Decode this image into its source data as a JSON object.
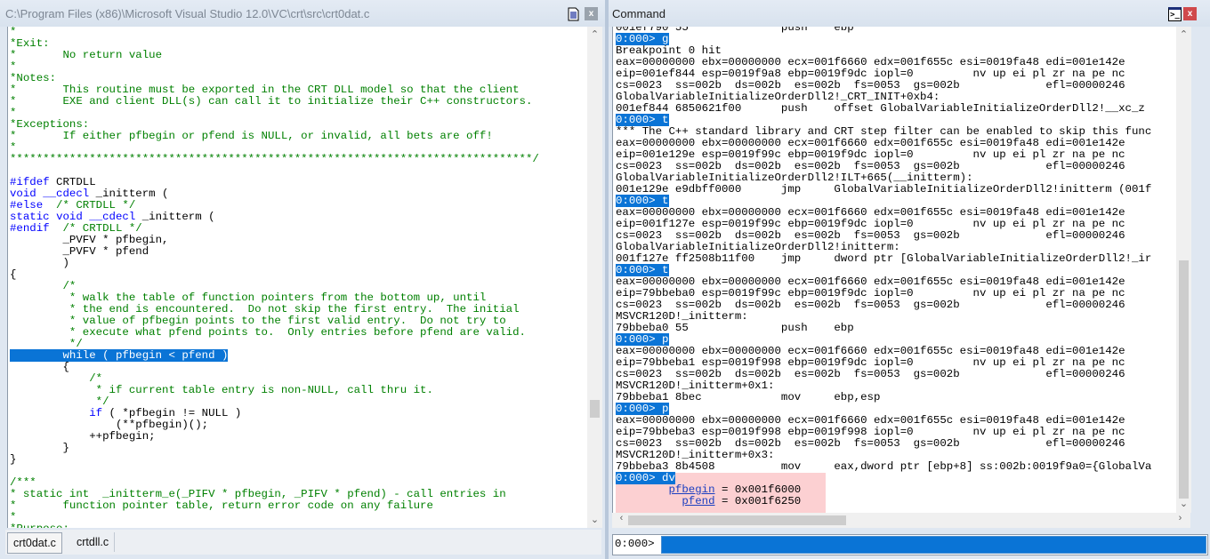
{
  "source_window": {
    "title": "C:\\Program Files (x86)\\Microsoft Visual Studio 12.0\\VC\\crt\\src\\crt0dat.c",
    "close_label": "x",
    "lines": [
      [
        {
          "t": "*",
          "s": "c"
        }
      ],
      [
        {
          "t": "*Exit:",
          "s": "c"
        }
      ],
      [
        {
          "t": "*       No return value",
          "s": "c"
        }
      ],
      [
        {
          "t": "*",
          "s": "c"
        }
      ],
      [
        {
          "t": "*Notes:",
          "s": "c"
        }
      ],
      [
        {
          "t": "*       This routine must be exported in the CRT DLL model so that the client",
          "s": "c"
        }
      ],
      [
        {
          "t": "*       EXE and client DLL(s) can call it to initialize their C++ constructors.",
          "s": "c"
        }
      ],
      [
        {
          "t": "*",
          "s": "c"
        }
      ],
      [
        {
          "t": "*Exceptions:",
          "s": "c"
        }
      ],
      [
        {
          "t": "*       If either pfbegin or pfend is NULL, or invalid, all bets are off!",
          "s": "c"
        }
      ],
      [
        {
          "t": "*",
          "s": "c"
        }
      ],
      [
        {
          "t": "*******************************************************************************/",
          "s": "c"
        }
      ],
      [
        {
          "t": "",
          "s": "p"
        }
      ],
      [
        {
          "t": "#ifdef",
          "s": "k"
        },
        {
          "t": " CRTDLL",
          "s": "p"
        }
      ],
      [
        {
          "t": "void",
          "s": "k"
        },
        {
          "t": " ",
          "s": "p"
        },
        {
          "t": "__cdecl",
          "s": "k"
        },
        {
          "t": " _initterm (",
          "s": "p"
        }
      ],
      [
        {
          "t": "#else",
          "s": "k"
        },
        {
          "t": "  /* CRTDLL */",
          "s": "c"
        }
      ],
      [
        {
          "t": "static",
          "s": "k"
        },
        {
          "t": " ",
          "s": "p"
        },
        {
          "t": "void",
          "s": "k"
        },
        {
          "t": " ",
          "s": "p"
        },
        {
          "t": "__cdecl",
          "s": "k"
        },
        {
          "t": " _initterm (",
          "s": "p"
        }
      ],
      [
        {
          "t": "#endif",
          "s": "k"
        },
        {
          "t": "  /* CRTDLL */",
          "s": "c"
        }
      ],
      [
        {
          "t": "        _PVFV * pfbegin,",
          "s": "p"
        }
      ],
      [
        {
          "t": "        _PVFV * pfend",
          "s": "p"
        }
      ],
      [
        {
          "t": "        )",
          "s": "p"
        }
      ],
      [
        {
          "t": "{",
          "s": "p"
        }
      ],
      [
        {
          "t": "        /*",
          "s": "c"
        }
      ],
      [
        {
          "t": "         * walk the table of function pointers from the bottom up, until",
          "s": "c"
        }
      ],
      [
        {
          "t": "         * the end is encountered.  Do not skip the first entry.  The initial",
          "s": "c"
        }
      ],
      [
        {
          "t": "         * value of pfbegin points to the first valid entry.  Do not try to",
          "s": "c"
        }
      ],
      [
        {
          "t": "         * execute what pfend points to.  Only entries before pfend are valid.",
          "s": "c"
        }
      ],
      [
        {
          "t": "         */",
          "s": "c"
        }
      ],
      [
        {
          "t": "        while ( pfbegin < pfend )",
          "s": "sel"
        }
      ],
      [
        {
          "t": "        {",
          "s": "p"
        }
      ],
      [
        {
          "t": "            /*",
          "s": "c"
        }
      ],
      [
        {
          "t": "             * if current table entry is non-NULL, call thru it.",
          "s": "c"
        }
      ],
      [
        {
          "t": "             */",
          "s": "c"
        }
      ],
      [
        {
          "t": "            ",
          "s": "p"
        },
        {
          "t": "if",
          "s": "k"
        },
        {
          "t": " ( *pfbegin != NULL )",
          "s": "p"
        }
      ],
      [
        {
          "t": "                (**pfbegin)();",
          "s": "p"
        }
      ],
      [
        {
          "t": "            ++pfbegin;",
          "s": "p"
        }
      ],
      [
        {
          "t": "        }",
          "s": "p"
        }
      ],
      [
        {
          "t": "}",
          "s": "p"
        }
      ],
      [
        {
          "t": "",
          "s": "p"
        }
      ],
      [
        {
          "t": "/***",
          "s": "c"
        }
      ],
      [
        {
          "t": "* static int  _initterm_e(_PIFV * pfbegin, _PIFV * pfend) - call entries in",
          "s": "c"
        }
      ],
      [
        {
          "t": "*       function pointer table, return error code on any failure",
          "s": "c"
        }
      ],
      [
        {
          "t": "*",
          "s": "c"
        }
      ],
      [
        {
          "t": "*Purpose:",
          "s": "c"
        }
      ]
    ],
    "tabs": [
      {
        "label": "crt0dat.c",
        "active": true
      },
      {
        "label": "crtdll.c",
        "active": false
      }
    ]
  },
  "command_window": {
    "title": "Command",
    "close_label": "x",
    "output": [
      [
        {
          "t": "001ef790 55              push    ebp",
          "s": "p"
        }
      ],
      [
        {
          "t": "0:000> g",
          "s": "prompt"
        }
      ],
      [
        {
          "t": "Breakpoint 0 hit",
          "s": "p"
        }
      ],
      [
        {
          "t": "eax=00000000 ebx=00000000 ecx=001f6660 edx=001f655c esi=0019fa48 edi=001e142e",
          "s": "p"
        }
      ],
      [
        {
          "t": "eip=001ef844 esp=0019f9a8 ebp=0019f9dc iopl=0         nv up ei pl zr na pe nc",
          "s": "p"
        }
      ],
      [
        {
          "t": "cs=0023  ss=002b  ds=002b  es=002b  fs=0053  gs=002b             efl=00000246",
          "s": "p"
        }
      ],
      [
        {
          "t": "GlobalVariableInitializeOrderDll2!_CRT_INIT+0xb4:",
          "s": "p"
        }
      ],
      [
        {
          "t": "001ef844 6850621f00      push    offset GlobalVariableInitializeOrderDll2!__xc_z",
          "s": "p"
        }
      ],
      [
        {
          "t": "0:000> t",
          "s": "prompt"
        }
      ],
      [
        {
          "t": "*** The C++ standard library and CRT step filter can be enabled to skip this func",
          "s": "p"
        }
      ],
      [
        {
          "t": "eax=00000000 ebx=00000000 ecx=001f6660 edx=001f655c esi=0019fa48 edi=001e142e",
          "s": "p"
        }
      ],
      [
        {
          "t": "eip=001e129e esp=0019f99c ebp=0019f9dc iopl=0         nv up ei pl zr na pe nc",
          "s": "p"
        }
      ],
      [
        {
          "t": "cs=0023  ss=002b  ds=002b  es=002b  fs=0053  gs=002b             efl=00000246",
          "s": "p"
        }
      ],
      [
        {
          "t": "GlobalVariableInitializeOrderDll2!ILT+665(__initterm):",
          "s": "p"
        }
      ],
      [
        {
          "t": "001e129e e9dbff0000      jmp     GlobalVariableInitializeOrderDll2!initterm (001f",
          "s": "p"
        }
      ],
      [
        {
          "t": "0:000> t",
          "s": "prompt"
        }
      ],
      [
        {
          "t": "eax=00000000 ebx=00000000 ecx=001f6660 edx=001f655c esi=0019fa48 edi=001e142e",
          "s": "p"
        }
      ],
      [
        {
          "t": "eip=001f127e esp=0019f99c ebp=0019f9dc iopl=0         nv up ei pl zr na pe nc",
          "s": "p"
        }
      ],
      [
        {
          "t": "cs=0023  ss=002b  ds=002b  es=002b  fs=0053  gs=002b             efl=00000246",
          "s": "p"
        }
      ],
      [
        {
          "t": "GlobalVariableInitializeOrderDll2!initterm:",
          "s": "p"
        }
      ],
      [
        {
          "t": "001f127e ff2508b11f00    jmp     dword ptr [GlobalVariableInitializeOrderDll2!_ir",
          "s": "p"
        }
      ],
      [
        {
          "t": "0:000> t",
          "s": "prompt"
        }
      ],
      [
        {
          "t": "eax=00000000 ebx=00000000 ecx=001f6660 edx=001f655c esi=0019fa48 edi=001e142e",
          "s": "p"
        }
      ],
      [
        {
          "t": "eip=79bbeba0 esp=0019f99c ebp=0019f9dc iopl=0         nv up ei pl zr na pe nc",
          "s": "p"
        }
      ],
      [
        {
          "t": "cs=0023  ss=002b  ds=002b  es=002b  fs=0053  gs=002b             efl=00000246",
          "s": "p"
        }
      ],
      [
        {
          "t": "MSVCR120D!_initterm:",
          "s": "p"
        }
      ],
      [
        {
          "t": "79bbeba0 55              push    ebp",
          "s": "p"
        }
      ],
      [
        {
          "t": "0:000> p",
          "s": "prompt"
        }
      ],
      [
        {
          "t": "eax=00000000 ebx=00000000 ecx=001f6660 edx=001f655c esi=0019fa48 edi=001e142e",
          "s": "p"
        }
      ],
      [
        {
          "t": "eip=79bbeba1 esp=0019f998 ebp=0019f9dc iopl=0         nv up ei pl zr na pe nc",
          "s": "p"
        }
      ],
      [
        {
          "t": "cs=0023  ss=002b  ds=002b  es=002b  fs=0053  gs=002b             efl=00000246",
          "s": "p"
        }
      ],
      [
        {
          "t": "MSVCR120D!_initterm+0x1:",
          "s": "p"
        }
      ],
      [
        {
          "t": "79bbeba1 8bec            mov     ebp,esp",
          "s": "p"
        }
      ],
      [
        {
          "t": "0:000> p",
          "s": "prompt"
        }
      ],
      [
        {
          "t": "eax=00000000 ebx=00000000 ecx=001f6660 edx=001f655c esi=0019fa48 edi=001e142e",
          "s": "p"
        }
      ],
      [
        {
          "t": "eip=79bbeba3 esp=0019f998 ebp=0019f998 iopl=0         nv up ei pl zr na pe nc",
          "s": "p"
        }
      ],
      [
        {
          "t": "cs=0023  ss=002b  ds=002b  es=002b  fs=0053  gs=002b             efl=00000246",
          "s": "p"
        }
      ],
      [
        {
          "t": "MSVCR120D!_initterm+0x3:",
          "s": "p"
        }
      ],
      [
        {
          "t": "79bbeba3 8b4508          mov     eax,dword ptr [ebp+8] ss:002b:0019f9a0={GlobalVa",
          "s": "p"
        }
      ]
    ],
    "dv_command": "0:000> dv",
    "dv_vars": [
      {
        "pad": "        ",
        "name": "pfbegin",
        "value": " = 0x001f6000"
      },
      {
        "pad": "          ",
        "name": "pfend",
        "value": " = 0x001f6250"
      }
    ],
    "input_prompt": "0:000>",
    "input_value": ""
  }
}
